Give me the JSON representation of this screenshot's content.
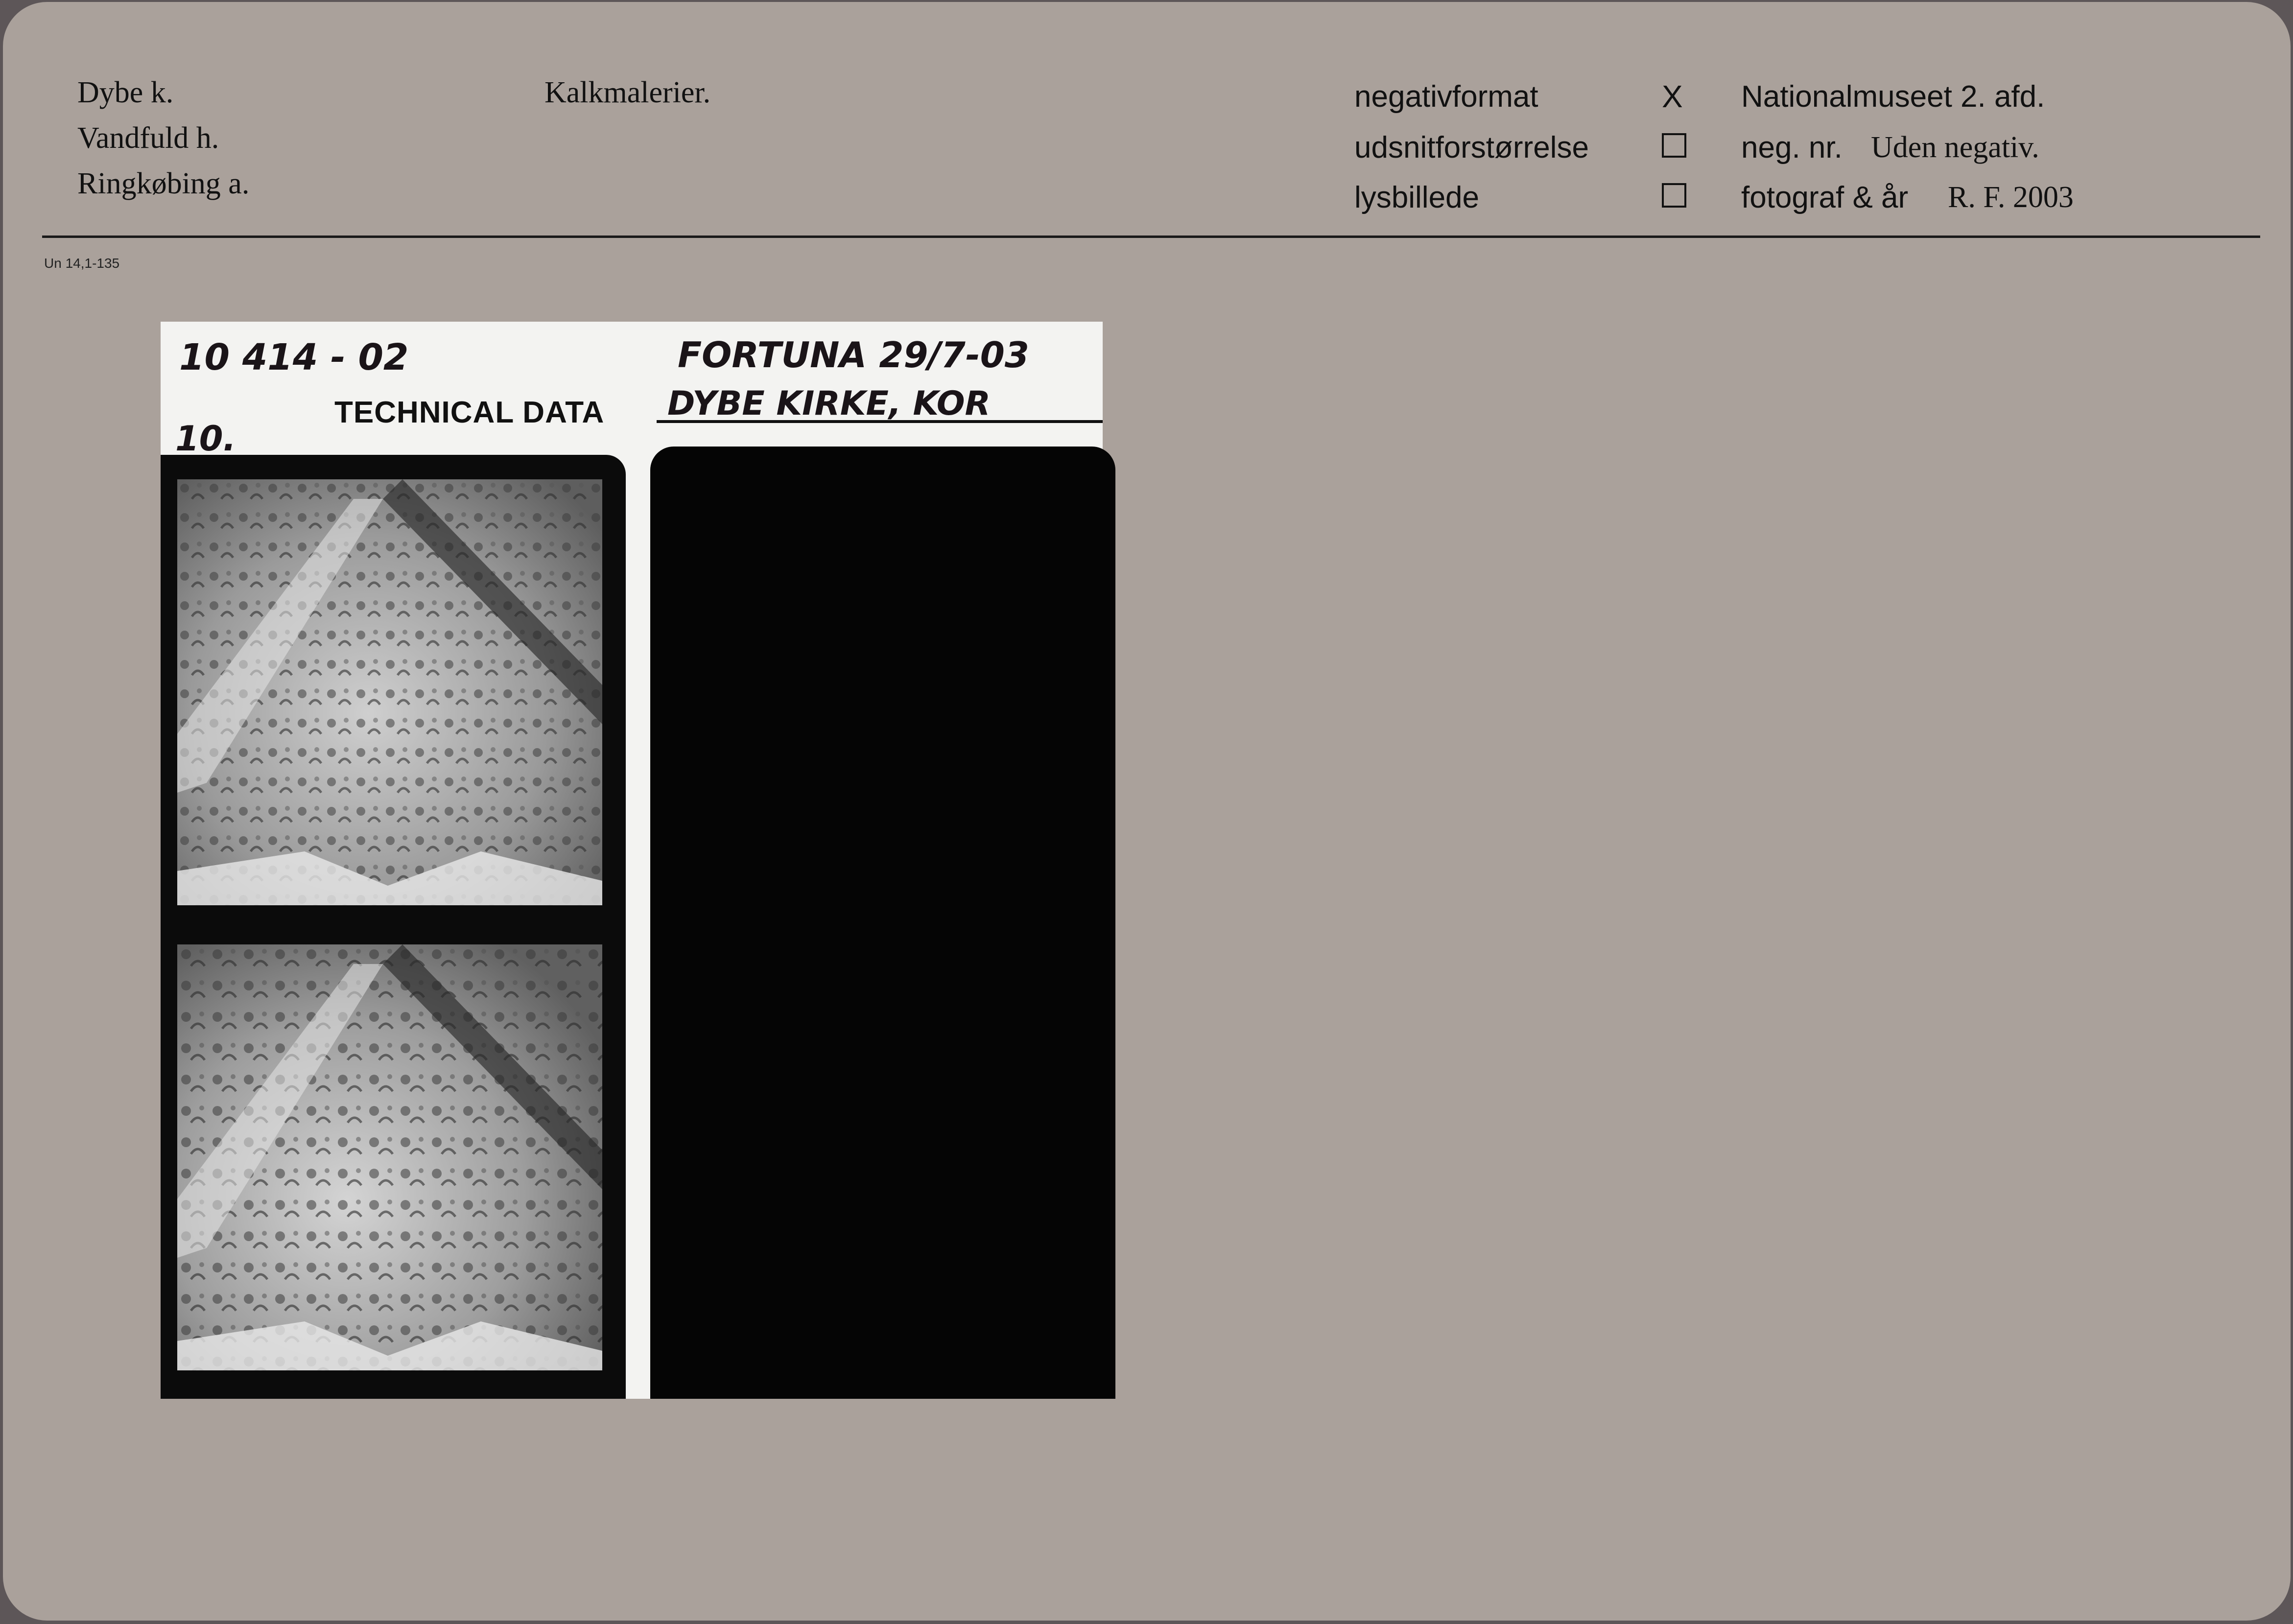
{
  "header": {
    "location_lines": [
      "Dybe k.",
      "Vandfuld h.",
      "Ringkøbing a."
    ],
    "subject": "Kalkmalerier.",
    "format_labels": {
      "negativformat": "negativformat",
      "udsnit": "udsnitforstørrelse",
      "lysbillede": "lysbillede"
    },
    "negativformat_mark": "X",
    "institution": "Nationalmuseet 2. afd.",
    "neg_nr_label": "neg. nr.",
    "neg_nr_value": "Uden negativ.",
    "fotograf_label": "fotograf & år",
    "fotograf_value": "R. F. 2003"
  },
  "catalog_code": "Un 14,1-135",
  "print": {
    "handwritten_number": "10 414 - 02",
    "handwritten_frame": "10.",
    "handwritten_film": "FORTUNA 29/7-03",
    "handwritten_site": "DYBE KIRKE, KOR",
    "technical_label": "TECHNICAL DATA",
    "frames": [
      {
        "subject": "vault-painting"
      },
      {
        "subject": "vault-painting"
      }
    ]
  },
  "colors": {
    "card": "#aaa19b",
    "border": "#5d5658",
    "print_paper": "#f3f3f1",
    "film_black": "#0b0b0b"
  }
}
